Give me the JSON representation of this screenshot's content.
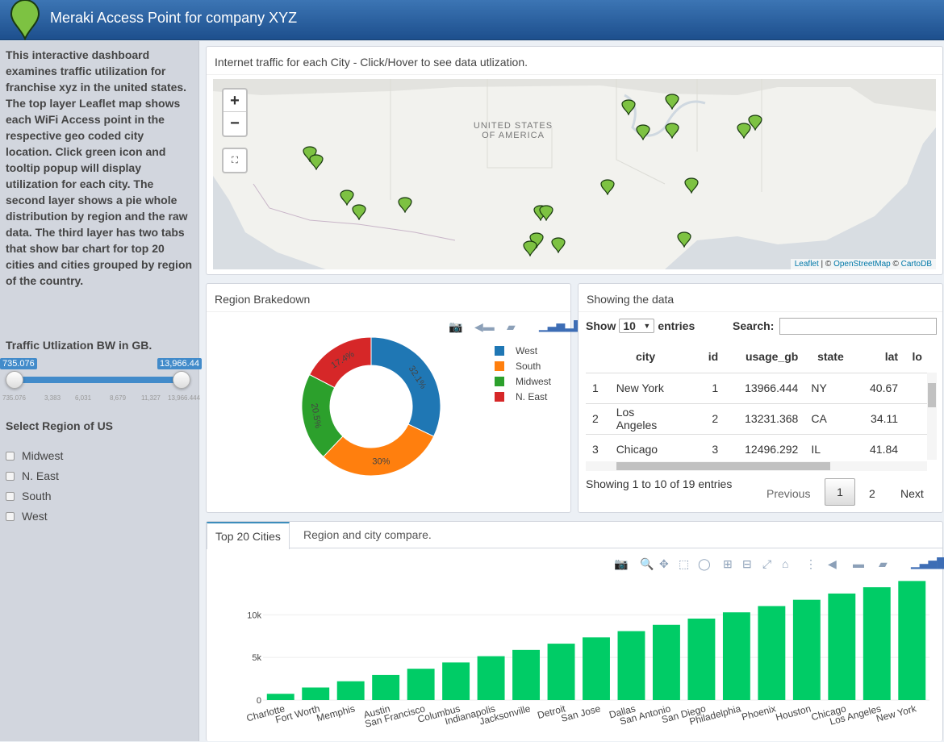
{
  "header": {
    "title": "Meraki Access Point for company XYZ"
  },
  "sidebar": {
    "intro": "This interactive dashboard examines traffic utilization for franchise xyz in the united states. The top layer Leaflet map shows each WiFi Access point in the respective geo coded city location. Click green icon and tooltip popup will display utilization for each city. The second layer shows a pie whole distribution by region and the raw data. The third layer has two tabs that show bar chart for top 20 cities and cities grouped by region of the country.",
    "slider_label": "Traffic Utlization BW in GB.",
    "slider_min_label": "735.076",
    "slider_max_label": "13,966.44",
    "slider_ticks": [
      "735.076",
      "3,383",
      "6,031",
      "8,679",
      "11,327",
      "13,966.444"
    ],
    "region_label": "Select Region of US",
    "regions": [
      "Midwest",
      "N. East",
      "South",
      "West"
    ]
  },
  "map_box": {
    "title": "Internet traffic for each City - Click/Hover to see data utlization.",
    "zoom_in": "+",
    "zoom_out": "−",
    "country_label_1": "UNITED STATES",
    "country_label_2": "OF AMERICA",
    "attrib_leaflet": "Leaflet",
    "attrib_sep1": " | © ",
    "attrib_osm": "OpenStreetMap",
    "attrib_sep2": " © ",
    "attrib_carto": "CartoDB",
    "marker_color": "#7dc242"
  },
  "pie_box": {
    "title": "Region Brakedown",
    "legend": [
      {
        "name": "West",
        "color": "#1f77b4"
      },
      {
        "name": "South",
        "color": "#ff7f0e"
      },
      {
        "name": "Midwest",
        "color": "#2ca02c"
      },
      {
        "name": "N. East",
        "color": "#d62728"
      }
    ]
  },
  "table_box": {
    "title": "Showing the data",
    "show_label": "Show",
    "entries_label": "entries",
    "page_size": "10",
    "search_label": "Search:",
    "columns": [
      "",
      "city",
      "id",
      "usage_gb",
      "state",
      "lat",
      "lo"
    ],
    "rows": [
      [
        "1",
        "New York",
        "1",
        "13966.444",
        "NY",
        "40.67"
      ],
      [
        "2",
        "Los Angeles",
        "2",
        "13231.368",
        "CA",
        "34.11"
      ],
      [
        "3",
        "Chicago",
        "3",
        "12496.292",
        "IL",
        "41.84"
      ]
    ],
    "info": "Showing 1 to 10 of 19 entries",
    "prev": "Previous",
    "pages": [
      "1",
      "2"
    ],
    "next": "Next"
  },
  "bar_box": {
    "tabs": [
      "Top 20 Cities",
      "Region and city compare."
    ],
    "bar_color": "#00cc66"
  },
  "chart_data": [
    {
      "type": "pie",
      "labels": [
        "West",
        "South",
        "Midwest",
        "N. East"
      ],
      "values": [
        32.1,
        30.0,
        20.5,
        17.4
      ],
      "value_labels": [
        "32.1%",
        "30%",
        "20.5%",
        "17.4%"
      ],
      "hole": true,
      "legend_position": "top-right"
    },
    {
      "type": "bar",
      "categories": [
        "Charlotte",
        "Fort Worth",
        "Memphis",
        "Austin",
        "San Francisco",
        "Columbus",
        "Indianapolis",
        "Jacksonville",
        "Detroit",
        "San Jose",
        "Dallas",
        "San Antonio",
        "San Diego",
        "Philadelphia",
        "Phoenix",
        "Houston",
        "Chicago",
        "Los Angeles",
        "New York"
      ],
      "values": [
        735,
        1470,
        2205,
        2940,
        3675,
        4410,
        5145,
        5880,
        6615,
        7350,
        8085,
        8820,
        9555,
        10290,
        11026,
        11761,
        12496,
        13231,
        13966
      ],
      "ytick_labels": [
        "0",
        "5k",
        "10k"
      ],
      "yticks": [
        0,
        5000,
        10000
      ],
      "ylim": [
        0,
        14000
      ],
      "grid": true
    }
  ]
}
